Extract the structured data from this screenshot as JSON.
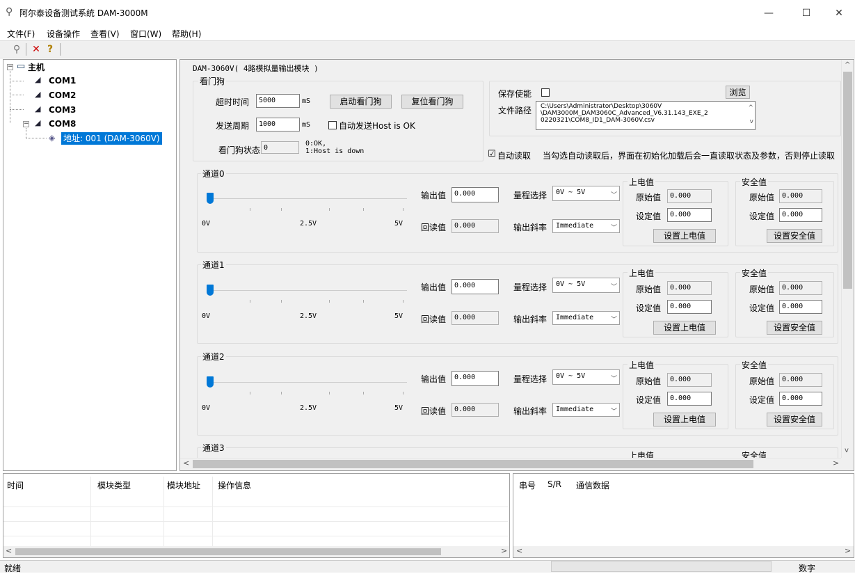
{
  "window": {
    "title": "阿尔泰设备测试系统 DAM-3000M",
    "minimize": "—",
    "maximize": "☐",
    "close": "✕"
  },
  "menu": [
    "文件(F)",
    "设备操作",
    "查看(V)",
    "窗口(W)",
    "帮助(H)"
  ],
  "toolbar": {
    "icons": [
      "search-icon",
      "delete-icon",
      "help-icon"
    ],
    "search": "⚲",
    "delete": "✕",
    "help": "?"
  },
  "tree": {
    "root": "主机",
    "coms": [
      "COM1",
      "COM2",
      "COM3",
      "COM8"
    ],
    "device": "地址: 001 (DAM-3060V)",
    "expand_root": "−",
    "expand_com8": "−"
  },
  "module": {
    "title": "DAM-3060V( 4路模拟量输出模块 )"
  },
  "watchdog": {
    "group_label": "看门狗",
    "timeout_label": "超时时间",
    "timeout_value": "5000",
    "timeout_unit": "mS",
    "start_btn": "启动看门狗",
    "reset_btn": "复位看门狗",
    "period_label": "发送周期",
    "period_value": "1000",
    "period_unit": "mS",
    "auto_send_label": "自动发送Host is OK",
    "status_label": "看门狗状态",
    "status_value": "0",
    "status_legend_1": "0:OK,",
    "status_legend_2": "1:Host is down"
  },
  "save": {
    "enable_label": "保存使能",
    "browse_btn": "浏览",
    "path_label": "文件路径",
    "path_lines": [
      "C:\\Users\\Administrator\\Desktop\\3060V",
      "\\DAM3000M_DAM3060C_Advanced_V6.31.143_EXE_2",
      "0220321\\COM8_ID1_DAM-3060V.csv"
    ]
  },
  "auto_read": {
    "label": "自动读取",
    "checked": "☑",
    "note": "当勾选自动读取后，界面在初始化加载后会一直读取状态及参数，否则停止读取"
  },
  "channels": [
    {
      "label": "通道0",
      "output_label": "输出值",
      "output": "0.000",
      "readback_label": "回读值",
      "readback": "0.000",
      "range_label": "量程选择",
      "range": "0V ~ 5V",
      "rate_label": "输出斜率",
      "rate": "Immediate",
      "slider_min": "0V",
      "slider_mid": "2.5V",
      "slider_max": "5V",
      "slider_level": 0,
      "power_label": "上电值",
      "power_raw_label": "原始值",
      "power_raw": "0.000",
      "power_set_label": "设定值",
      "power_set": "0.000",
      "power_btn": "设置上电值",
      "safe_label": "安全值",
      "safe_raw_label": "原始值",
      "safe_raw": "0.000",
      "safe_set_label": "设定值",
      "safe_set": "0.000",
      "safe_btn": "设置安全值"
    },
    {
      "label": "通道1",
      "output_label": "输出值",
      "output": "0.000",
      "readback_label": "回读值",
      "readback": "0.000",
      "range_label": "量程选择",
      "range": "0V ~ 5V",
      "rate_label": "输出斜率",
      "rate": "Immediate",
      "slider_min": "0V",
      "slider_mid": "2.5V",
      "slider_max": "5V",
      "slider_level": 0,
      "power_label": "上电值",
      "power_raw_label": "原始值",
      "power_raw": "0.000",
      "power_set_label": "设定值",
      "power_set": "0.000",
      "power_btn": "设置上电值",
      "safe_label": "安全值",
      "safe_raw_label": "原始值",
      "safe_raw": "0.000",
      "safe_set_label": "设定值",
      "safe_set": "0.000",
      "safe_btn": "设置安全值"
    },
    {
      "label": "通道2",
      "output_label": "输出值",
      "output": "0.000",
      "readback_label": "回读值",
      "readback": "0.000",
      "range_label": "量程选择",
      "range": "0V ~ 5V",
      "rate_label": "输出斜率",
      "rate": "Immediate",
      "slider_min": "0V",
      "slider_mid": "2.5V",
      "slider_max": "5V",
      "slider_level": 0,
      "power_label": "上电值",
      "power_raw_label": "原始值",
      "power_raw": "0.000",
      "power_set_label": "设定值",
      "power_set": "0.000",
      "power_btn": "设置上电值",
      "safe_label": "安全值",
      "safe_raw_label": "原始值",
      "safe_raw": "0.000",
      "safe_set_label": "设定值",
      "safe_set": "0.000",
      "safe_btn": "设置安全值"
    },
    {
      "label": "通道3",
      "power_label": "上电值",
      "safe_label": "安全值"
    }
  ],
  "log": {
    "headers": [
      "时间",
      "模块类型",
      "模块地址",
      "操作信息"
    ]
  },
  "comm": {
    "headers": [
      "串号",
      "S/R",
      "通信数据"
    ]
  },
  "status": {
    "left": "就绪",
    "right": "数字"
  },
  "scroll": {
    "left": "<",
    "right": ">",
    "up": "^",
    "down": "v"
  }
}
